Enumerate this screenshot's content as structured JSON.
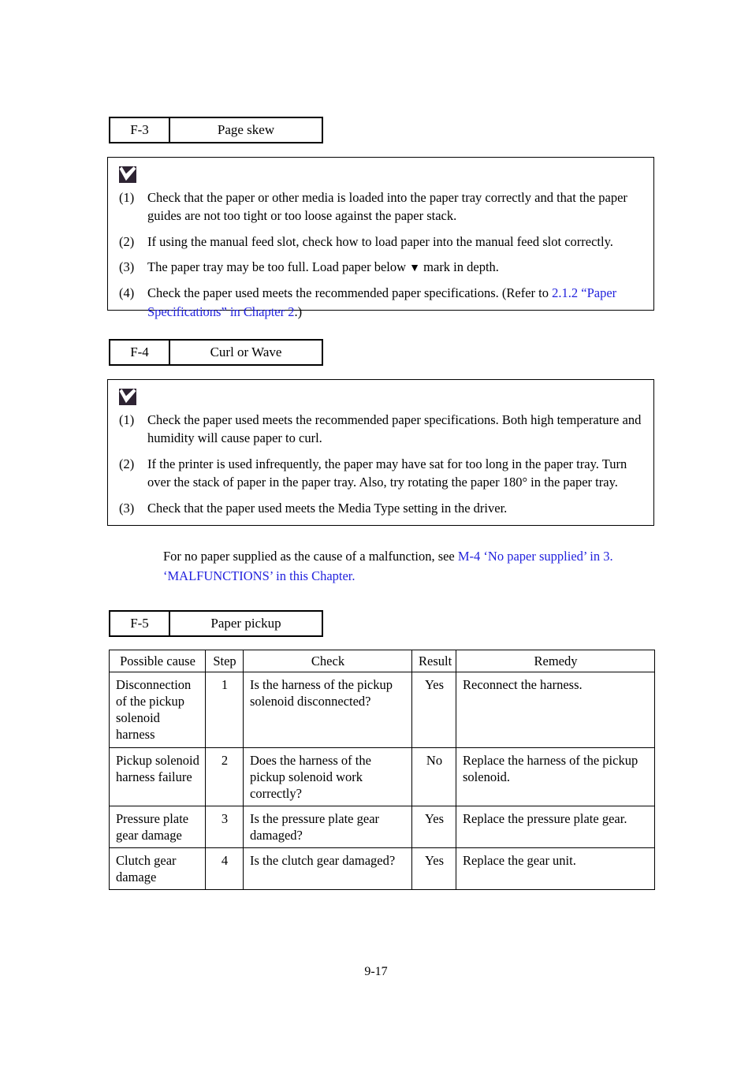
{
  "page": {
    "footer": "9-17"
  },
  "sections": [
    {
      "code": "F-3",
      "name": "Page skew",
      "icon": "check-mark-box-icon",
      "items": [
        {
          "num": "(1)",
          "parts": [
            {
              "text": "Check that the paper or other media is loaded into the paper tray correctly and that the paper guides are not too tight or too loose against the paper stack.",
              "style": "plain"
            }
          ]
        },
        {
          "num": "(2)",
          "parts": [
            {
              "text": "If using the manual feed slot, check how to load paper into the manual feed slot correctly.",
              "style": "plain"
            }
          ]
        },
        {
          "num": "(3)",
          "parts": [
            {
              "text": "The paper tray may be too full.  Load paper below ",
              "style": "plain"
            },
            {
              "text": "▼",
              "style": "triangle"
            },
            {
              "text": "  mark in depth.",
              "style": "plain"
            }
          ]
        },
        {
          "num": "(4)",
          "parts": [
            {
              "text": "Check the paper used meets the recommended paper specifications. (Refer to ",
              "style": "plain"
            },
            {
              "text": "2.1.2 “Paper Specifications” in Chapter 2",
              "style": "link"
            },
            {
              "text": ".)",
              "style": "plain"
            }
          ]
        }
      ]
    },
    {
      "code": "F-4",
      "name": "Curl or Wave",
      "icon": "check-mark-box-icon",
      "items": [
        {
          "num": "(1)",
          "parts": [
            {
              "text": "Check the paper used meets the recommended paper specifications.  Both high temperature and humidity will cause paper to curl.",
              "style": "plain"
            }
          ]
        },
        {
          "num": "(2)",
          "parts": [
            {
              "text": "If the printer is used infrequently, the paper may have sat for too long in the paper tray.  Turn over the stack of paper in the paper tray.  Also, try rotating the paper 180° in the paper tray.",
              "style": "plain"
            }
          ]
        },
        {
          "num": "(3)",
          "parts": [
            {
              "text": "Check that the paper used meets the Media Type setting in the driver.",
              "style": "plain"
            }
          ]
        }
      ]
    }
  ],
  "note_paragraph": {
    "parts": [
      {
        "text": "For no paper supplied as the cause of a malfunction, see ",
        "style": "plain"
      },
      {
        "text": "M-4 ‘No paper supplied’ in 3. ‘MALFUNCTIONS’ in this Chapter.",
        "style": "link"
      }
    ]
  },
  "table_section": {
    "code": "F-5",
    "name": "Paper pickup"
  },
  "table": {
    "headers": [
      "Possible cause",
      "Step",
      "Check",
      "Result",
      "Remedy"
    ],
    "rows": [
      {
        "cause": "Disconnection of the pickup solenoid harness",
        "step": "1",
        "check": "Is the harness of the pickup solenoid disconnected?",
        "result": "Yes",
        "remedy": "Reconnect the harness."
      },
      {
        "cause": "Pickup solenoid harness failure",
        "step": "2",
        "check": "Does the harness of the pickup solenoid work correctly?",
        "result": "No",
        "remedy": "Replace the harness of the pickup solenoid."
      },
      {
        "cause": "Pressure plate gear damage",
        "step": "3",
        "check": "Is the pressure plate gear damaged?",
        "result": "Yes",
        "remedy": "Replace the pressure plate gear."
      },
      {
        "cause": "Clutch gear damage",
        "step": "4",
        "check": "Is the clutch gear damaged?",
        "result": "Yes",
        "remedy": "Replace the gear unit."
      }
    ]
  },
  "colors": {
    "link": "#2222dd",
    "text": "#000000",
    "icon": "#2e2433"
  }
}
